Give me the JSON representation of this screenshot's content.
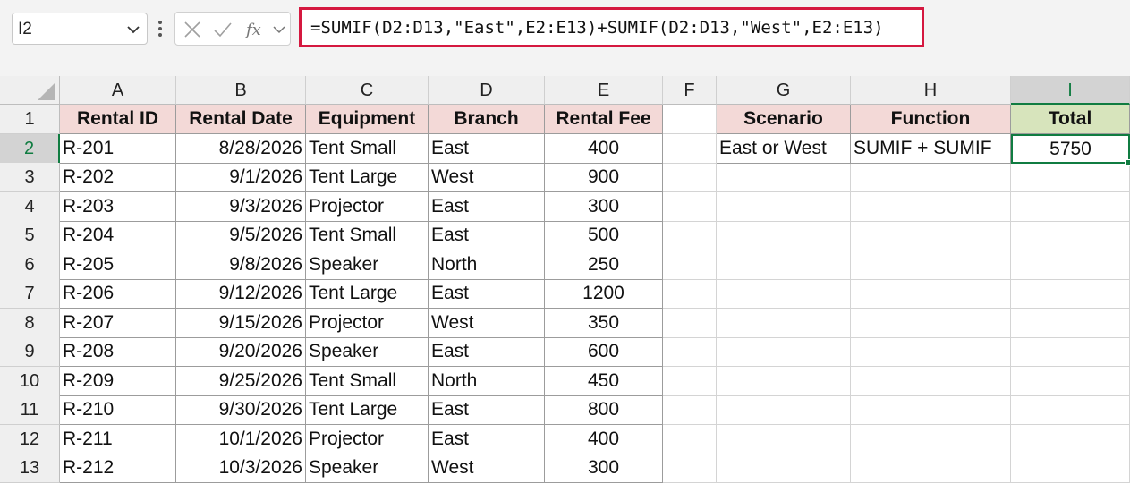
{
  "name_box": {
    "value": "I2"
  },
  "formula_bar": {
    "formula": "=SUMIF(D2:D13,\"East\",E2:E13)+SUMIF(D2:D13,\"West\",E2:E13)"
  },
  "columns": [
    "A",
    "B",
    "C",
    "D",
    "E",
    "F",
    "G",
    "H",
    "I"
  ],
  "rows": [
    "1",
    "2",
    "3",
    "4",
    "5",
    "6",
    "7",
    "8",
    "9",
    "10",
    "11",
    "12",
    "13"
  ],
  "selected_column": "I",
  "selected_row": "2",
  "table": {
    "headers": [
      "Rental ID",
      "Rental Date",
      "Equipment",
      "Branch",
      "Rental Fee"
    ],
    "rows": [
      [
        "R-201",
        "8/28/2026",
        "Tent Small",
        "East",
        "400"
      ],
      [
        "R-202",
        "9/1/2026",
        "Tent Large",
        "West",
        "900"
      ],
      [
        "R-203",
        "9/3/2026",
        "Projector",
        "East",
        "300"
      ],
      [
        "R-204",
        "9/5/2026",
        "Tent Small",
        "East",
        "500"
      ],
      [
        "R-205",
        "9/8/2026",
        "Speaker",
        "North",
        "250"
      ],
      [
        "R-206",
        "9/12/2026",
        "Tent Large",
        "East",
        "1200"
      ],
      [
        "R-207",
        "9/15/2026",
        "Projector",
        "West",
        "350"
      ],
      [
        "R-208",
        "9/20/2026",
        "Speaker",
        "East",
        "600"
      ],
      [
        "R-209",
        "9/25/2026",
        "Tent Small",
        "North",
        "450"
      ],
      [
        "R-210",
        "9/30/2026",
        "Tent Large",
        "East",
        "800"
      ],
      [
        "R-211",
        "10/1/2026",
        "Projector",
        "East",
        "400"
      ],
      [
        "R-212",
        "10/3/2026",
        "Speaker",
        "West",
        "300"
      ]
    ]
  },
  "summary": {
    "headers": [
      "Scenario",
      "Function",
      "Total"
    ],
    "row": [
      "East or West",
      "SUMIF + SUMIF",
      "5750"
    ]
  },
  "colors": {
    "header_pink": "#f3d9d7",
    "header_green": "#d7e4bc",
    "excel_green": "#107c41",
    "formula_highlight": "#d5183f"
  },
  "icons": [
    "chevron-down-icon",
    "more-vertical-icon",
    "cancel-x-icon",
    "enter-check-icon",
    "function-fx-icon"
  ]
}
